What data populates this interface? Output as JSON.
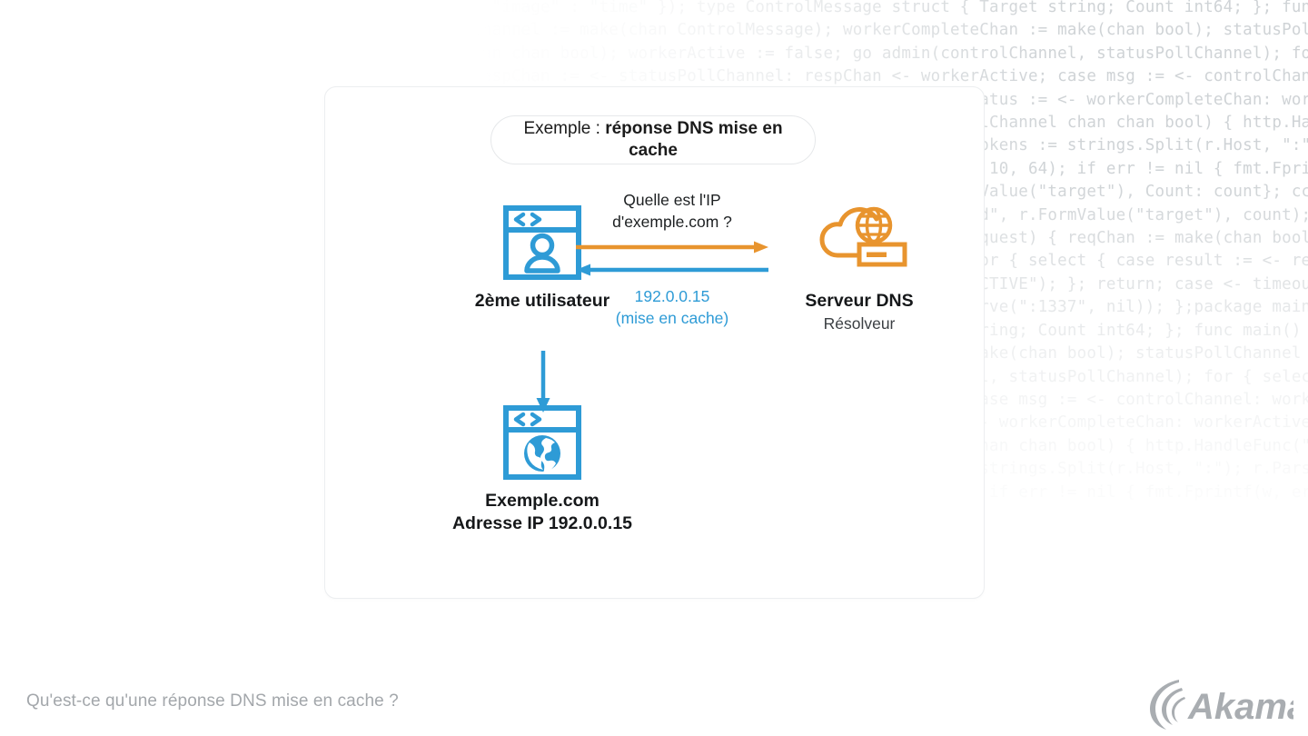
{
  "background": {
    "code_snippet": "{ \"image\" : \"time\" }); type ControlMessage struct { Target string; Count int64; }; func main() { controlChannel := make(chan ControlMessage); workerCompleteChan := make(chan bool); statusPollChannel := make(chan chan bool); workerActive := false; go admin(controlChannel, statusPollChannel); for { select { case respChan := <- statusPollChannel: respChan <- workerActive; case msg := <- controlChannel: workerActive = true; go doStuff(msg, workerCompleteChan); case status := <- workerCompleteChan: workerActive = status; }}}; func admin(cc chan ControlMessage, statusPollChannel chan chan bool) { http.HandleFunc(\"/admin\", func(w http.ResponseWriter, r *http.Request) { hostTokens := strings.Split(r.Host, \":\"); r.ParseForm(); count, err := strconv.ParseInt(r.FormValue(\"count\"), 10, 64); if err != nil { fmt.Fprintf(w, err.Error()); return; }; msg := ControlMessage{Target: r.FormValue(\"target\"), Count: count}; cc <- msg; fmt.Fprintf(w, \"Control message issued for Target %s, count %d\", r.FormValue(\"target\"), count); }); http.HandleFunc(\"/status\", func(w http.ResponseWriter, r *http.Request) { reqChan := make(chan bool); statusPollChannel <- reqChan; timeout := time.After(time.Second); for { select { case result := <- reqChan: if result { fmt.Fprint(w, \"ACTIVE\"); } else { fmt.Fprint(w, \"INACTIVE\"); }; return; case <- timeout: fmt.Fprint(w, \"TIMEOUT\"); return; }}}); log.Fatal(http.ListenAndServe(\":1337\", nil)); };package main; import ( \"fmt\" \"net/http\" ); type ControlMessage struct { Target string; Count int64; }; func main() { controlChannel := make(chan ControlMessage); workerCompleteChan := make(chan bool); statusPollChannel := make(chan chan bool); workerActive := false; go admin(controlChannel, statusPollChannel); for { select { case respChan := <- statusPollChannel: respChan <- workerActive; case msg := <- controlChannel: workerActive = true; go doStuff(msg, workerCompleteChan); case status := <- workerCompleteChan: workerActive = status; }}}; func admin(cc chan ControlMessage, statusPollChannel chan chan bool) { http.HandleFunc(\"/admin\", func(w http.ResponseWriter, r *http.Request) { hostTokens := strings.Split(r.Host, \":\"); r.ParseForm(); count, err := strconv.ParseInt(r.FormValue(\"count\"), 10, 64); if err != nil { fmt.Fprintf(w, err.Error()); return; }"
  },
  "card": {
    "title_prefix": "Exemple : ",
    "title_strong": "réponse DNS mise en cache"
  },
  "nodes": {
    "user": {
      "icon": "browser-user-icon",
      "label": "2ème utilisateur"
    },
    "dns_server": {
      "icon": "cloud-dns-server-icon",
      "label": "Serveur DNS",
      "sublabel": "Résolveur"
    },
    "website": {
      "icon": "browser-globe-icon",
      "label_line1": "Exemple.com",
      "label_line2": "Adresse IP 192.0.0.15"
    }
  },
  "arrows": {
    "request": {
      "caption": "Quelle est l'IP\nd'exemple.com ?",
      "direction": "right",
      "color": "#e8942e",
      "name": "dns-query-arrow"
    },
    "response": {
      "caption": "192.0.0.15\n(mise en cache)",
      "direction": "left",
      "color": "#2e9bd6",
      "name": "dns-response-arrow"
    },
    "user_to_site": {
      "direction": "down",
      "color": "#2e9bd6",
      "name": "user-to-website-arrow"
    }
  },
  "footer": {
    "caption": "Qu'est-ce qu'une réponse DNS mise en cache ?",
    "logo_text": "Akamai"
  },
  "colors": {
    "blue": "#2e9bd6",
    "orange": "#e8942e",
    "text_dark": "#16181a",
    "caption_gray": "#a3a7ab",
    "card_border": "#eceef0"
  }
}
